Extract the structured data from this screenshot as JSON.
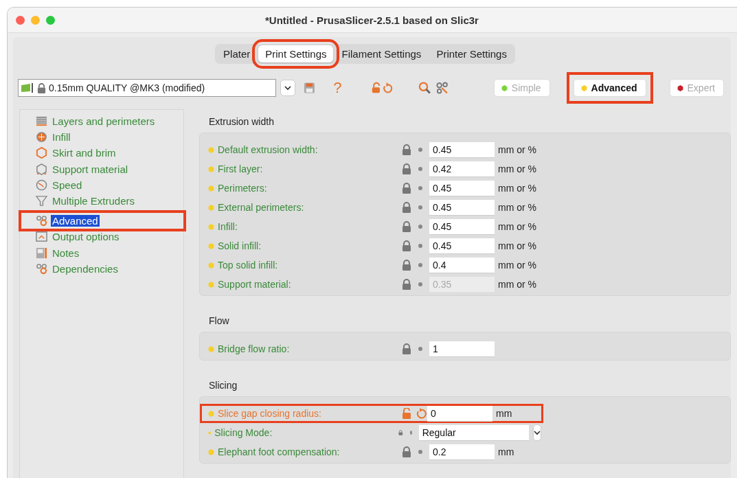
{
  "window": {
    "title": "*Untitled - PrusaSlicer-2.5.1 based on Slic3r"
  },
  "tabs": [
    {
      "label": "Plater",
      "selected": false,
      "highlighted": false
    },
    {
      "label": "Print Settings",
      "selected": true,
      "highlighted": true
    },
    {
      "label": "Filament Settings",
      "selected": false,
      "highlighted": false
    },
    {
      "label": "Printer Settings",
      "selected": false,
      "highlighted": false
    }
  ],
  "preset": {
    "value": "0.15mm QUALITY @MK3 (modified)"
  },
  "toolbar": {
    "help": "?"
  },
  "modes": [
    {
      "label": "Simple",
      "selected": false,
      "highlighted": false,
      "color": "#7dd23c"
    },
    {
      "label": "Advanced",
      "selected": true,
      "highlighted": true,
      "color": "#f5cf2a"
    },
    {
      "label": "Expert",
      "selected": false,
      "highlighted": false,
      "color": "#c8202a"
    }
  ],
  "sidebar": {
    "items": [
      {
        "label": "Layers and perimeters",
        "selected": false,
        "highlighted": false
      },
      {
        "label": "Infill",
        "selected": false,
        "highlighted": false
      },
      {
        "label": "Skirt and brim",
        "selected": false,
        "highlighted": false
      },
      {
        "label": "Support material",
        "selected": false,
        "highlighted": false
      },
      {
        "label": "Speed",
        "selected": false,
        "highlighted": false
      },
      {
        "label": "Multiple Extruders",
        "selected": false,
        "highlighted": false
      },
      {
        "label": "Advanced",
        "selected": true,
        "highlighted": true
      },
      {
        "label": "Output options",
        "selected": false,
        "highlighted": false
      },
      {
        "label": "Notes",
        "selected": false,
        "highlighted": false
      },
      {
        "label": "Dependencies",
        "selected": false,
        "highlighted": false
      }
    ]
  },
  "groups": [
    {
      "title": "Extrusion width",
      "rows": [
        {
          "kind": "text",
          "label": "Default extrusion width:",
          "value": "0.45",
          "unit": "mm or %",
          "modified": false,
          "disabled": false,
          "highlighted": false
        },
        {
          "kind": "text",
          "label": "First layer:",
          "value": "0.42",
          "unit": "mm or %",
          "modified": false,
          "disabled": false,
          "highlighted": false
        },
        {
          "kind": "text",
          "label": "Perimeters:",
          "value": "0.45",
          "unit": "mm or %",
          "modified": false,
          "disabled": false,
          "highlighted": false
        },
        {
          "kind": "text",
          "label": "External perimeters:",
          "value": "0.45",
          "unit": "mm or %",
          "modified": false,
          "disabled": false,
          "highlighted": false
        },
        {
          "kind": "text",
          "label": "Infill:",
          "value": "0.45",
          "unit": "mm or %",
          "modified": false,
          "disabled": false,
          "highlighted": false
        },
        {
          "kind": "text",
          "label": "Solid infill:",
          "value": "0.45",
          "unit": "mm or %",
          "modified": false,
          "disabled": false,
          "highlighted": false
        },
        {
          "kind": "text",
          "label": "Top solid infill:",
          "value": "0.4",
          "unit": "mm or %",
          "modified": false,
          "disabled": false,
          "highlighted": false
        },
        {
          "kind": "text",
          "label": "Support material:",
          "value": "0.35",
          "unit": "mm or %",
          "modified": false,
          "disabled": true,
          "highlighted": false
        }
      ]
    },
    {
      "title": "Flow",
      "rows": [
        {
          "kind": "text",
          "label": "Bridge flow ratio:",
          "value": "1",
          "modified": false,
          "disabled": false,
          "highlighted": false
        }
      ]
    },
    {
      "title": "Slicing",
      "rows": [
        {
          "kind": "text",
          "label": "Slice gap closing radius:",
          "value": "0",
          "unit": "mm",
          "modified": true,
          "disabled": false,
          "highlighted": true
        },
        {
          "kind": "select",
          "label": "Slicing Mode:",
          "value": "Regular",
          "modified": false,
          "disabled": false,
          "highlighted": false
        },
        {
          "kind": "text",
          "label": "Elephant foot compensation:",
          "value": "0.2",
          "unit": "mm",
          "modified": false,
          "disabled": false,
          "highlighted": false
        }
      ]
    }
  ]
}
